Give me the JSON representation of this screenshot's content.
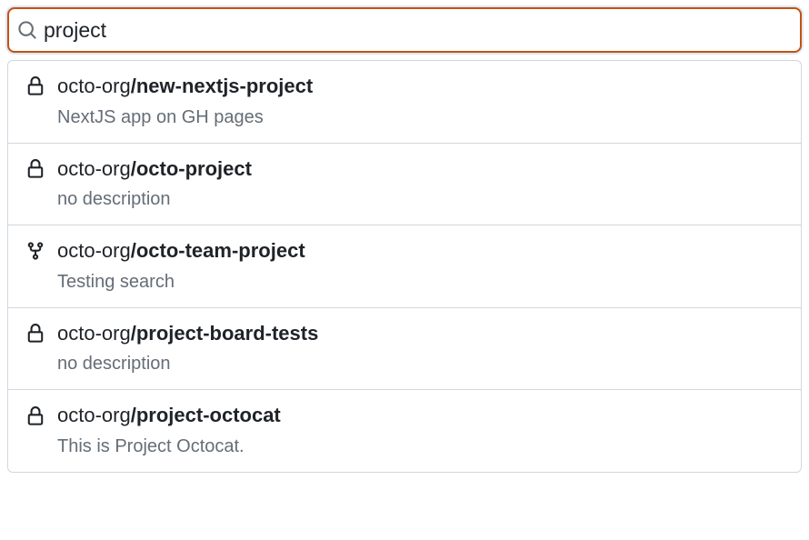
{
  "search": {
    "value": "project",
    "placeholder": ""
  },
  "results": [
    {
      "icon": "lock",
      "owner": "octo-org",
      "name": "new-nextjs-project",
      "description": "NextJS app on GH pages"
    },
    {
      "icon": "lock",
      "owner": "octo-org",
      "name": "octo-project",
      "description": "no description"
    },
    {
      "icon": "fork",
      "owner": "octo-org",
      "name": "octo-team-project",
      "description": "Testing search"
    },
    {
      "icon": "lock",
      "owner": "octo-org",
      "name": "project-board-tests",
      "description": "no description"
    },
    {
      "icon": "lock",
      "owner": "octo-org",
      "name": "project-octocat",
      "description": "This is Project Octocat."
    }
  ]
}
